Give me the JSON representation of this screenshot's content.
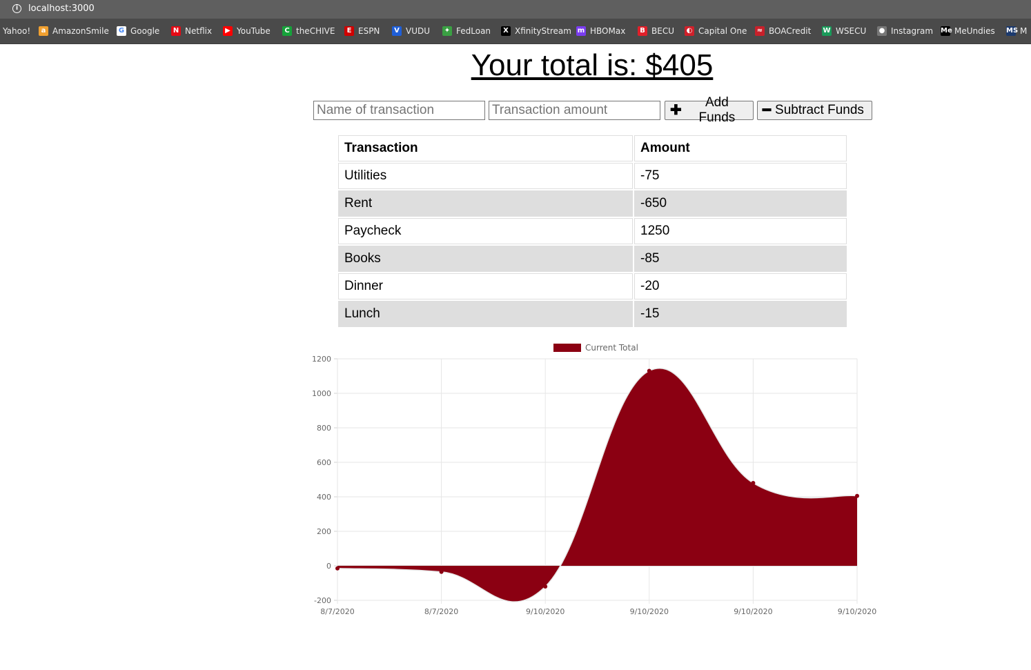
{
  "browser": {
    "url": "localhost:3000",
    "bookmarks": [
      {
        "label": "Yahoo!",
        "icon": "",
        "color": ""
      },
      {
        "label": "AmazonSmile",
        "icon": "a",
        "color": "#f0a030"
      },
      {
        "label": "Google",
        "icon": "G",
        "color": "#ffffff"
      },
      {
        "label": "Netflix",
        "icon": "N",
        "color": "#e50914"
      },
      {
        "label": "YouTube",
        "icon": "▶",
        "color": "#ff0000"
      },
      {
        "label": "theCHIVE",
        "icon": "C",
        "color": "#16a23a"
      },
      {
        "label": "ESPN",
        "icon": "E",
        "color": "#d00000"
      },
      {
        "label": "VUDU",
        "icon": "V",
        "color": "#1f5fd8"
      },
      {
        "label": "FedLoan",
        "icon": "✦",
        "color": "#3aa043"
      },
      {
        "label": "XfinityStream",
        "icon": "X",
        "color": "#000000"
      },
      {
        "label": "HBOMax",
        "icon": "m",
        "color": "#7a3cf0"
      },
      {
        "label": "BECU",
        "icon": "B",
        "color": "#e0202a"
      },
      {
        "label": "Capital One",
        "icon": "◐",
        "color": "#d0202a"
      },
      {
        "label": "BOACredit",
        "icon": "≈",
        "color": "#c8202a"
      },
      {
        "label": "WSECU",
        "icon": "W",
        "color": "#1a9a5a"
      },
      {
        "label": "Instagram",
        "icon": "●",
        "color": "#777777"
      },
      {
        "label": "MeUndies",
        "icon": "Me",
        "color": "#000000"
      },
      {
        "label": "M",
        "icon": "MS",
        "color": "#1c3a6e"
      }
    ]
  },
  "page": {
    "title": "Your total is: $405"
  },
  "form": {
    "name_placeholder": "Name of transaction",
    "amount_placeholder": "Transaction amount",
    "add_label": "Add Funds",
    "subtract_label": "Subtract Funds"
  },
  "table": {
    "headers": [
      "Transaction",
      "Amount"
    ],
    "rows": [
      {
        "name": "Utilities",
        "amount": "-75"
      },
      {
        "name": "Rent",
        "amount": "-650"
      },
      {
        "name": "Paycheck",
        "amount": "1250"
      },
      {
        "name": "Books",
        "amount": "-85"
      },
      {
        "name": "Dinner",
        "amount": "-20"
      },
      {
        "name": "Lunch",
        "amount": "-15"
      }
    ]
  },
  "chart_data": {
    "type": "area",
    "x": [
      "8/7/2020",
      "8/7/2020",
      "9/10/2020",
      "9/10/2020",
      "9/10/2020",
      "9/10/2020"
    ],
    "series": [
      {
        "name": "Current Total",
        "values": [
          -15,
          -35,
          -120,
          1130,
          480,
          405
        ],
        "color": "#8b0012"
      }
    ],
    "yticks": [
      1200,
      1000,
      800,
      600,
      400,
      200,
      0,
      -200
    ],
    "ylim": [
      -200,
      1200
    ],
    "grid": true,
    "legend": "top"
  }
}
